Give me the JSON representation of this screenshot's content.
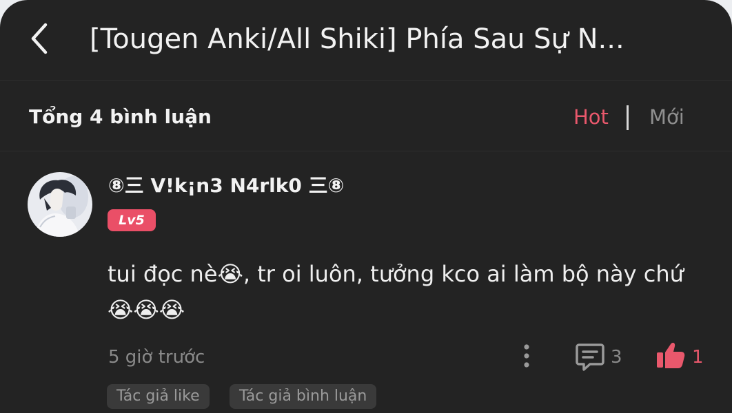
{
  "header": {
    "title": "[Tougen Anki/All Shiki] Phía Sau Sự N..."
  },
  "sort_bar": {
    "count_label": "Tổng 4 bình luận",
    "hot_label": "Hot",
    "new_label": "Mới"
  },
  "comment": {
    "username": "⑧三 V!k¡n3 N4rlk0 三⑧",
    "level": "Lv5",
    "text": "tui đọc nè😭, tr oi luôn, tưởng kco ai làm bộ này chứ\n😭😭😭",
    "time": "5 giờ trước",
    "reply_count": "3",
    "like_count": "1",
    "tags": [
      "Tác giả like",
      "Tác giả bình luận"
    ]
  },
  "colors": {
    "background": "#232323",
    "accent": "#e9586c",
    "muted_text": "#8a8a8a"
  },
  "icons": [
    "back-arrow-icon",
    "more-vertical-icon",
    "comment-icon",
    "thumbs-up-icon"
  ]
}
